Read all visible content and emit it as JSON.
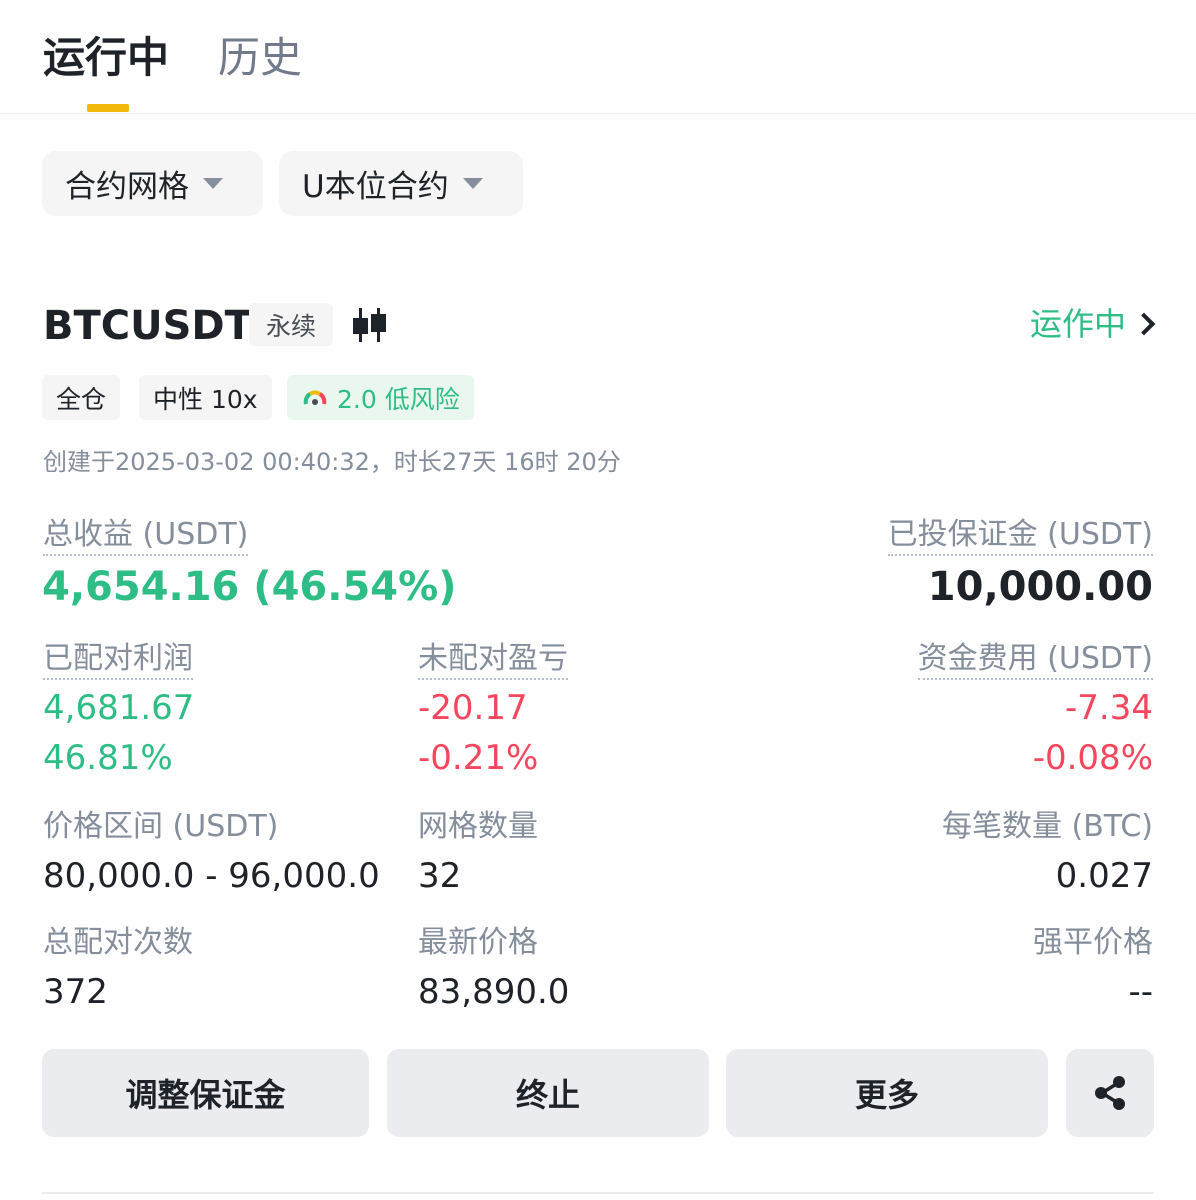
{
  "tabs": {
    "running": "运行中",
    "history": "历史"
  },
  "filters": {
    "strategy": "合约网格",
    "contract_type": "U本位合约"
  },
  "bot": {
    "symbol": "BTCUSDT",
    "perp_label": "永续",
    "status": "运作中",
    "chips": {
      "margin_mode": "全仓",
      "direction_leverage": "中性 10x",
      "risk": "2.0 低风险"
    },
    "created": "创建于2025-03-02 00:40:32，时长27天 16时 20分"
  },
  "stats": {
    "total_profit_label": "总收益 (USDT)",
    "total_profit_value": "4,654.16 (46.54%)",
    "invested_margin_label": "已投保证金 (USDT)",
    "invested_margin_value": "10,000.00",
    "matched_profit_label": "已配对利润",
    "matched_profit_value": "4,681.67",
    "matched_profit_pct": "46.81%",
    "unmatched_pnl_label": "未配对盈亏",
    "unmatched_pnl_value": "-20.17",
    "unmatched_pnl_pct": "-0.21%",
    "funding_fee_label": "资金费用 (USDT)",
    "funding_fee_value": "-7.34",
    "funding_fee_pct": "-0.08%",
    "price_range_label": "价格区间 (USDT)",
    "price_range_value": "80,000.0 - 96,000.0",
    "grid_count_label": "网格数量",
    "grid_count_value": "32",
    "per_order_qty_label": "每笔数量 (BTC)",
    "per_order_qty_value": "0.027",
    "total_matches_label": "总配对次数",
    "total_matches_value": "372",
    "last_price_label": "最新价格",
    "last_price_value": "83,890.0",
    "liq_price_label": "强平价格",
    "liq_price_value": "--"
  },
  "actions": {
    "adjust_margin": "调整保证金",
    "stop": "终止",
    "more": "更多"
  },
  "colors": {
    "accent": "#f0b90b",
    "up": "#2ebd85",
    "down": "#f6465d",
    "muted": "#848e9c"
  },
  "icons": {
    "filter_caret": "caret-down-icon",
    "kline": "candlestick-icon",
    "status_chevron": "chevron-right-icon",
    "risk": "gauge-icon",
    "share": "share-icon"
  }
}
